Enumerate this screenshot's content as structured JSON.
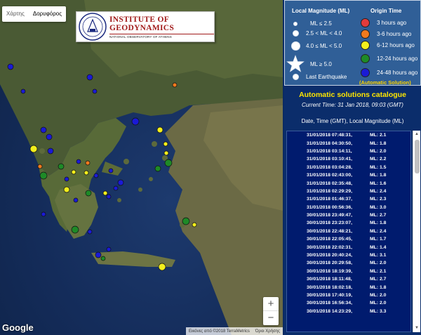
{
  "map": {
    "map_type_options": [
      "Χάρτης",
      "Δορυφόρος"
    ],
    "selected_map_type": "Δορυφόρος",
    "zoom_in": "+",
    "zoom_out": "−",
    "google_label": "Google",
    "attribution": [
      "Εικόνες από ©2018 TerraMetrics",
      "Όροι Χρήσης"
    ],
    "logo": {
      "title": "INSTITUTE OF GEODYNAMICS",
      "subtitle": "NATIONAL OBSERVATORY OF ATHENS"
    }
  },
  "legend": {
    "magnitude_title": "Local Magnitude (ML)",
    "origin_title": "Origin Time",
    "magnitudes": [
      "ML ≤ 2.5",
      "2.5 < ML < 4.0",
      "4.0 ≤ ML < 5.0",
      "ML ≥ 5.0",
      "Last Earthquake"
    ],
    "ages": [
      {
        "label": "3 hours ago",
        "color": "#e23b3b"
      },
      {
        "label": "3-6 hours ago",
        "color": "#f07a1e"
      },
      {
        "label": "6-12 hours ago",
        "color": "#f3ef1c"
      },
      {
        "label": "12-24 hours ago",
        "color": "#1e8a27"
      },
      {
        "label": "24-48 hours ago",
        "color": "#1a1ad6"
      }
    ],
    "auto_note": "(Automatic Solution)"
  },
  "catalogue": {
    "title": "Automatic solutions catalogue",
    "current_time": "Current Time: 31 Jan 2018, 09:03 (GMT)",
    "header": "Date, Time (GMT), Local Magnitude (ML)",
    "rows": [
      {
        "dt": "31/01/2018  07:48:31,",
        "ml": "ML: 2.1"
      },
      {
        "dt": "31/01/2018  04:30:50,",
        "ml": "ML: 1.8"
      },
      {
        "dt": "31/01/2018  03:14:11,",
        "ml": "ML: 2.0"
      },
      {
        "dt": "31/01/2018  03:10:41,",
        "ml": "ML: 2.2"
      },
      {
        "dt": "31/01/2018  03:04:28,",
        "ml": "ML: 1.5"
      },
      {
        "dt": "31/01/2018  02:43:00,",
        "ml": "ML: 1.8"
      },
      {
        "dt": "31/01/2018  02:35:48,",
        "ml": "ML: 1.6"
      },
      {
        "dt": "31/01/2018  02:29:29,",
        "ml": "ML: 2.4"
      },
      {
        "dt": "31/01/2018  01:46:37,",
        "ml": "ML: 2.3"
      },
      {
        "dt": "31/01/2018  00:56:36,",
        "ml": "ML: 3.0"
      },
      {
        "dt": "30/01/2018  23:49:47,",
        "ml": "ML: 2.7"
      },
      {
        "dt": "30/01/2018  23:23:07,",
        "ml": "ML: 1.8"
      },
      {
        "dt": "30/01/2018  22:48:21,",
        "ml": "ML: 2.4"
      },
      {
        "dt": "30/01/2018  22:05:45,",
        "ml": "ML: 1.7"
      },
      {
        "dt": "30/01/2018  22:02:31,",
        "ml": "ML: 1.4"
      },
      {
        "dt": "30/01/2018  20:40:24,",
        "ml": "ML: 3.1"
      },
      {
        "dt": "30/01/2018  20:29:58,",
        "ml": "ML: 2.0"
      },
      {
        "dt": "30/01/2018  18:19:39,",
        "ml": "ML: 2.1"
      },
      {
        "dt": "30/01/2018  18:11:48,",
        "ml": "ML: 2.7"
      },
      {
        "dt": "30/01/2018  18:02:18,",
        "ml": "ML: 1.8"
      },
      {
        "dt": "30/01/2018  17:40:19,",
        "ml": "ML: 2.0"
      },
      {
        "dt": "30/01/2018  16:56:34,",
        "ml": "ML: 2.0"
      },
      {
        "dt": "30/01/2018  14:23:29,",
        "ml": "ML: 3.3"
      }
    ]
  }
}
